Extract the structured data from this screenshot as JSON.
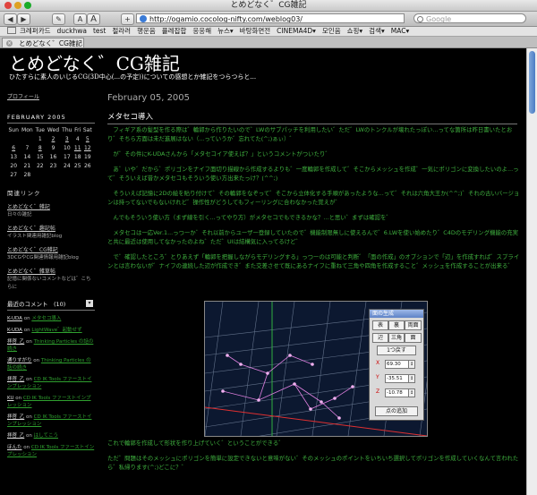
{
  "window": {
    "title": "とめどなく゛CG雑記"
  },
  "toolbar": {
    "back": "◀",
    "forward": "▶",
    "pencil": "✎",
    "font_small": "A",
    "font_large": "A",
    "add": "+",
    "url": "http://ogamio.cocolog-nifty.com/weblog03/",
    "search_placeholder": "Google"
  },
  "bookmarks": [
    "크레퍼카드",
    "duckhwa",
    "test",
    "절라러",
    "행운음",
    "플레잡합",
    "응응해",
    "뉴스▾",
    "바탕화면전",
    "CINEMA4D▾",
    "모인음",
    "쇼핑▾",
    "검색▾",
    "MAC▾"
  ],
  "tab": {
    "label": "とめどなく゛CG雑記",
    "close": "×"
  },
  "blog": {
    "title": "とめどなく゛CG雑記",
    "subtitle": "ひたすらに素人のいじるCG(3D中心(...の予定))についての感想とか雑記をつらつらと..."
  },
  "sidebar": {
    "profile": "プロフィール",
    "calendar": {
      "title": "FEBRUARY 2005",
      "weekdays": [
        "Sun",
        "Mon",
        "Tue",
        "Wed",
        "Thu",
        "Fri",
        "Sat"
      ],
      "rows": [
        [
          "",
          "",
          "1",
          "2",
          "3",
          "4",
          "5"
        ],
        [
          "6",
          "7",
          "8",
          "9",
          "10",
          "11",
          "12"
        ],
        [
          "13",
          "14",
          "15",
          "16",
          "17",
          "18",
          "19"
        ],
        [
          "20",
          "21",
          "22",
          "23",
          "24",
          "25",
          "26"
        ],
        [
          "27",
          "28",
          "",
          "",
          "",
          "",
          ""
        ]
      ]
    },
    "links_heading": "関連リンク",
    "links": [
      {
        "label": "とめどなく゛雑記",
        "desc": "日々の雑記"
      },
      {
        "label": "とめどなく゛趣記帖",
        "desc": "イラスト関連用雑記blog"
      },
      {
        "label": "とめどなく゛CG雑記",
        "desc": "3DCGやCG関連情報用雑記blog"
      },
      {
        "label": "とめどなく゛雑草帖",
        "desc": "記憶に関係ないコメントなどは゛こちらに"
      }
    ],
    "recent_comments": {
      "heading": "最近のコメント　(10)",
      "btn": "▾",
      "items": [
        {
          "author": "K-UDA",
          "on": "on",
          "topic": "メタセコ導入"
        },
        {
          "author": "K-UDA",
          "on": "on",
          "topic": "LightWave゛起動せず"
        },
        {
          "author": "拝啓_乙",
          "on": "on",
          "topic": "Thinking Particles の話の続き"
        },
        {
          "author": "通りすがり",
          "on": "on",
          "topic": "Thinking Particles の話の続き"
        },
        {
          "author": "拝啓_乙",
          "on": "on",
          "topic": "CD IK Tools ファーストインプレッション"
        },
        {
          "author": "KU",
          "on": "on",
          "topic": "CD IK Tools ファーストインプレッション"
        },
        {
          "author": "拝啓_乙",
          "on": "on",
          "topic": "CD IK Tools ファーストインプレッション"
        },
        {
          "author": "拝啓_乙",
          "on": "on",
          "topic": "はしてこう"
        },
        {
          "author": "ほんた",
          "on": "on",
          "topic": "CD IK Tools ファーストインプレッション"
        }
      ]
    }
  },
  "post": {
    "date": "February 05, 2005",
    "title": "メタセコ導入",
    "paragraphs": [
      "　フィギア系の髪型を作る際は゛輪郭から作りたいので゛LWのサブパッチを利用したい゛ただ゛LWのトンクルが壊れたっぽい...ってな箇所は昨日書いたとおり゛そちら方面は未だ進展はない（...っていうか゛忘れてた(^;)ぁぃ）゛",
      "　が゛その件にK-UDAさんから「メタセコイア使えば？」というコメントがついたり゛",
      "　あ゛いや゛だから゛ポリゴンをナイフ面切り描線から作成するよりも゛一度輪郭を作成して゛そこからメッシュを作成゛一気にポリゴンに変換したいのよ...って゛そういえば昔かメタセコもそういう使い方出来たっけ？(^^;)",
      "　そういえば記憶に2Dの絵を貼り付けて゛その輪郭をなぞって゛そこから立体化する手順があったような...って゛それは六角大王か(^^;)゛それの古いバージョンは持ってないでもないけれど゛操作性がどうしてもフィーリングに合わなかった覚えが゛",
      "　んでもそういう使い方（まず線を引く...ってやり方）がメタセコでもできるかな？...と思い゛まずは確認を゛",
      "　メタセコは一応Ver.1...っつーか゛それ以前からユーザー登録していたので゛機能制限無しに使えるんで゛6.LWを使い始めたり゛C4Dのモデリング機能の充実と共に最近は使用してなかったのよね゛ただ゛UIは結構気に入ってるけど゛",
      "　で゛確認したところ゛とりあえず「輪郭を把握しながらモデリングする」っつーのは可能と判断゛「面の作成」のオプションで「辺」を作成すれば゛スプラインとは言わないが゛ナイフの連続した辺が作成でき゛また交差させて既にあるナイフに重ねて三角や四角を作成すること゛メッシュを作成することが出来る゛"
    ],
    "after": [
      "これで輪郭を作成して形状を作り上げていく゛ということができる゛",
      "ただ゛問題はそのメッシュにポリゴンを簡単に設定できないと意味がない゛そのメッシュのポイントをいちいち選択してポリゴンを作成していくなんて言われたら゛私帰ります(^;)どこに？゛"
    ]
  },
  "panel": {
    "title": "面の生成",
    "row1": [
      "表",
      "裏",
      "両面"
    ],
    "row2": [
      "辺",
      "三角",
      "面"
    ],
    "back_one": "1つ戻す",
    "fields": [
      {
        "axis": "X",
        "value": "69.30"
      },
      {
        "axis": "Y",
        "value": "-35.51"
      },
      {
        "axis": "Z",
        "value": "-10.78"
      }
    ],
    "add_point": "点の追加"
  },
  "colors": {
    "background": "#000000",
    "post_text": "#3fb13f",
    "link_green": "#2fa02f",
    "viewport_bg": "#0c1830",
    "grid": "#7f8fa8",
    "vertex": "#e080e0",
    "axis_red": "#e03030",
    "axis_green": "#2fb040"
  }
}
